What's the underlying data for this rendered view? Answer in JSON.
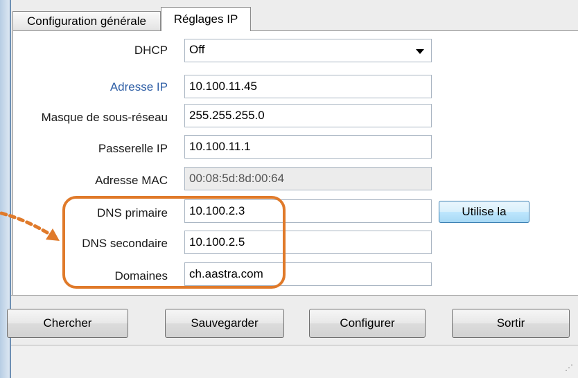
{
  "tabs": [
    {
      "label": "Configuration générale",
      "active": false
    },
    {
      "label": "Réglages IP",
      "active": true
    }
  ],
  "form": {
    "dhcp": {
      "label": "DHCP",
      "value": "Off"
    },
    "ip_address": {
      "label": "Adresse IP",
      "value": "10.100.11.45"
    },
    "subnet_mask": {
      "label": "Masque de sous-réseau",
      "value": "255.255.255.0"
    },
    "gateway": {
      "label": "Passerelle IP",
      "value": "10.100.11.1"
    },
    "mac_address": {
      "label": "Adresse MAC",
      "value": "00:08:5d:8d:00:64"
    },
    "dns_primary": {
      "label": "DNS primaire",
      "value": "10.100.2.3"
    },
    "dns_secondary": {
      "label": "DNS secondaire",
      "value": "10.100.2.5"
    },
    "domains": {
      "label": "Domaines",
      "value": "ch.aastra.com"
    },
    "use_button": "Utilise la"
  },
  "buttons": {
    "search": "Chercher",
    "save": "Sauvegarder",
    "configure": "Configurer",
    "exit": "Sortir"
  },
  "annotation": {
    "color": "#e07a2a"
  },
  "icons": {
    "dropdown": "chevron-down-icon",
    "grip": "resize-grip-icon"
  }
}
